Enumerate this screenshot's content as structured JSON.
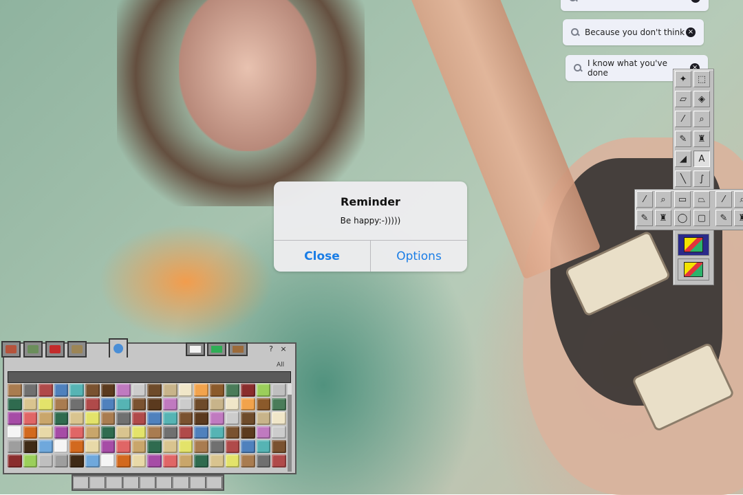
{
  "search_bubbles": [
    {
      "text": ""
    },
    {
      "text": "Because you don't think"
    },
    {
      "text": "I know what you've done"
    }
  ],
  "dialog": {
    "title": "Reminder",
    "message": "Be happy:-)))))",
    "close_label": "Close",
    "options_label": "Options"
  },
  "inventory": {
    "filter_label": "All",
    "help_label": "?",
    "close_label": "×"
  },
  "paint_tools": [
    {
      "name": "free-select",
      "glyph": "✦"
    },
    {
      "name": "rect-select",
      "glyph": "⬚"
    },
    {
      "name": "eraser",
      "glyph": "▱"
    },
    {
      "name": "fill",
      "glyph": "◈"
    },
    {
      "name": "picker",
      "glyph": "⁄"
    },
    {
      "name": "magnifier",
      "glyph": "⌕"
    },
    {
      "name": "pencil",
      "glyph": "✎"
    },
    {
      "name": "brush",
      "glyph": "♜"
    },
    {
      "name": "airbrush",
      "glyph": "◢"
    },
    {
      "name": "text",
      "glyph": "A"
    },
    {
      "name": "line",
      "glyph": "╲"
    },
    {
      "name": "curve",
      "glyph": "∫"
    }
  ]
}
